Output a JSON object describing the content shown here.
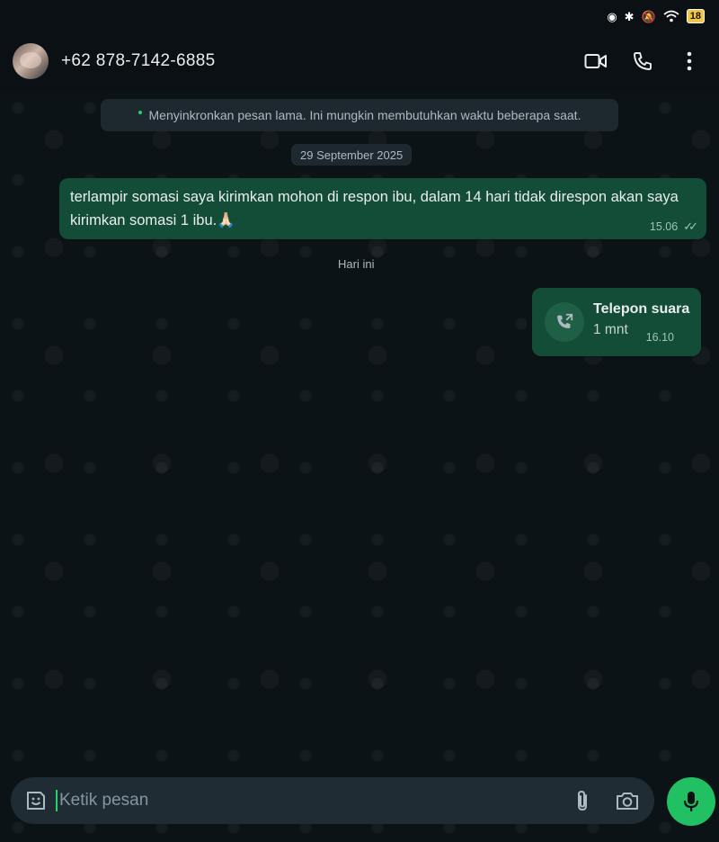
{
  "status_bar": {
    "battery": "18"
  },
  "header": {
    "contact": "+62 878-7142-6885"
  },
  "sync_notice": "Menyinkronkan pesan lama. Ini mungkin membutuhkan waktu beberapa saat.",
  "messages": [
    {
      "date": "29 September 2025",
      "text": "terlampir somasi saya kirimkan mohon di respon ibu, dalam 14 hari tidak direspon akan saya kirimkan somasi 1 ibu.🙏🏻",
      "time": "15.06",
      "status": "read"
    },
    {
      "date": "Hari ini",
      "call_title": "Telepon suara",
      "call_duration": "1 mnt",
      "time": "16.10"
    }
  ],
  "composer": {
    "placeholder": "Ketik pesan"
  },
  "colors": {
    "accent": "#21c063",
    "bubble_out": "#144d37",
    "background": "#0b1014"
  },
  "icons": [
    "video-call-icon",
    "voice-call-icon",
    "more-options-icon",
    "emoji-sticker-icon",
    "attach-icon",
    "camera-icon",
    "mic-icon",
    "outgoing-call-icon"
  ]
}
